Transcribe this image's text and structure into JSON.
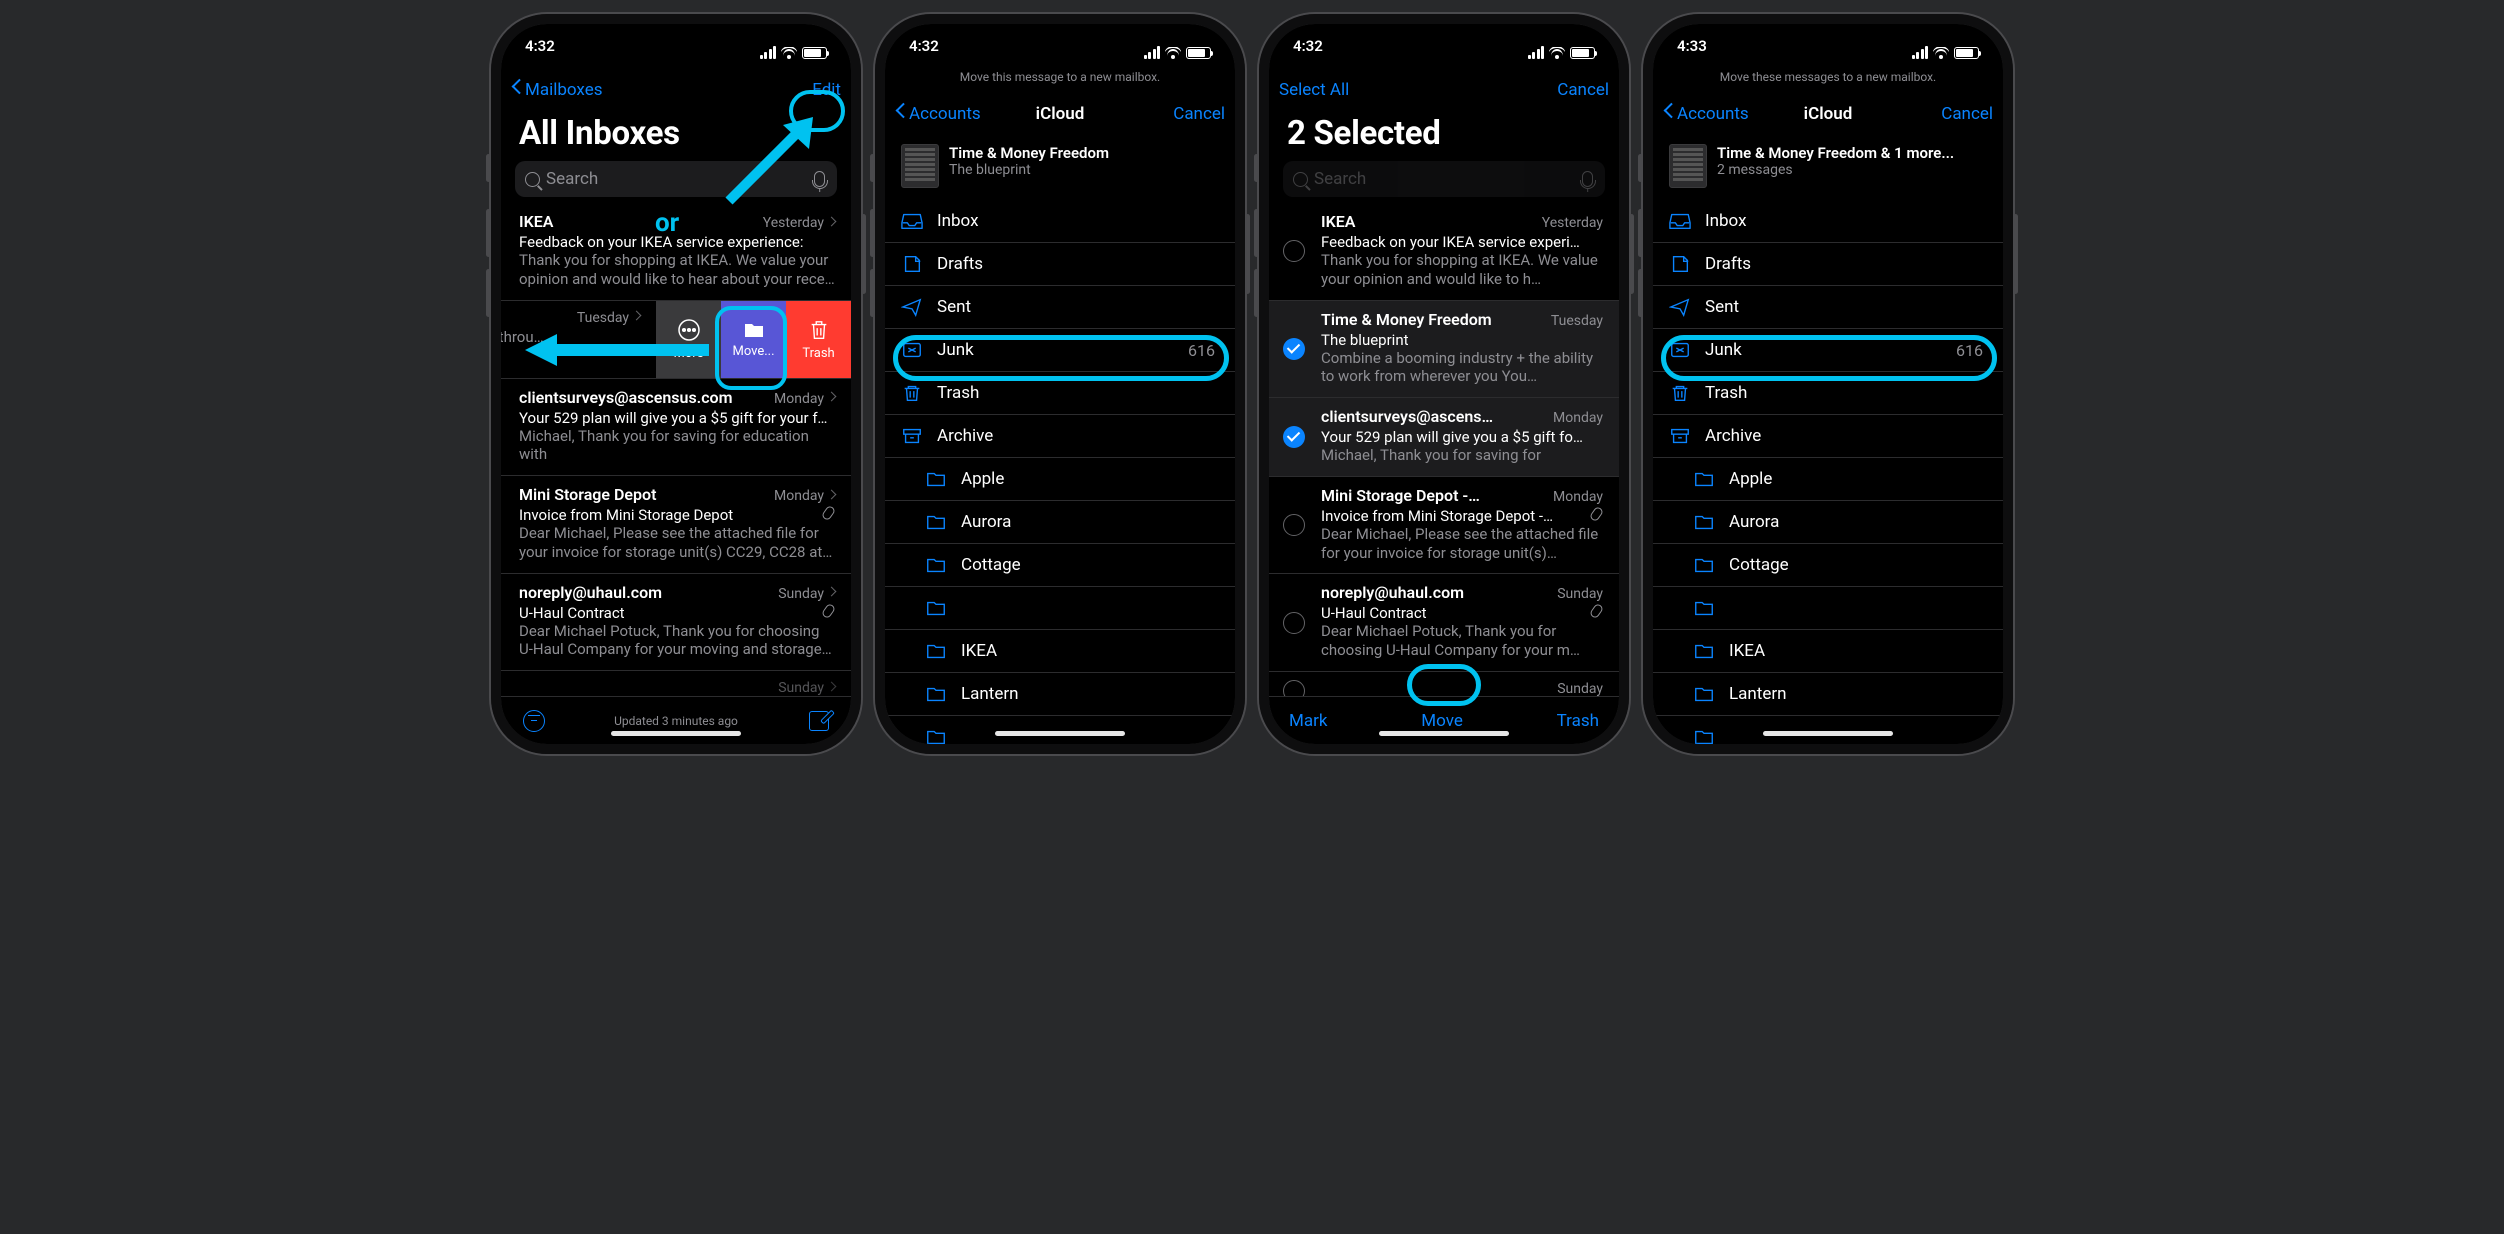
{
  "time": "4:32",
  "time4": "4:33",
  "p1": {
    "back": "Mailboxes",
    "edit": "Edit",
    "title": "All Inboxes",
    "search_ph": "Search",
    "or": "or",
    "status": "Updated 3 minutes ago",
    "swipe": {
      "more": "More",
      "move": "Move...",
      "trash": "Trash"
    },
    "rows": [
      {
        "sender": "IKEA",
        "date": "Yesterday",
        "subj": "Feedback on your IKEA service experience:",
        "prev": "Thank you for shopping at IKEA. We value your opinion and would like to hear about your rece…"
      },
      {
        "sender": "",
        "date": "Tuesday",
        "subj": "",
        "prev": "+ the ability to subscribed throu…"
      },
      {
        "sender": "clientsurveys@ascensus.com",
        "date": "Monday",
        "subj": "Your 529 plan will give you a $5 gift for your fe…",
        "prev": "Michael, Thank you for saving for education with"
      },
      {
        "sender": "Mini Storage Depot",
        "date": "Monday",
        "subj": "Invoice from Mini Storage Depot",
        "prev": "Dear Michael, Please see the attached file for your invoice for storage unit(s) CC29, CC28 at…",
        "attach": true
      },
      {
        "sender": "noreply@uhaul.com",
        "date": "Sunday",
        "subj": "U-Haul Contract",
        "prev": "Dear Michael Potuck, Thank you for choosing U-Haul Company for your moving and storage ne…",
        "attach": true
      },
      {
        "sender": "",
        "date": "Sunday",
        "subj": "",
        "prev": ""
      }
    ]
  },
  "p2": {
    "helper": "Move this message to a new mailbox.",
    "back": "Accounts",
    "title": "iCloud",
    "cancel": "Cancel",
    "msg": {
      "title": "Time & Money Freedom",
      "sub": "The blueprint"
    },
    "junk_count": "616",
    "folders": [
      "Inbox",
      "Drafts",
      "Sent",
      "Junk",
      "Trash",
      "Archive",
      "Apple",
      "Aurora",
      "Cottage",
      "",
      "IKEA",
      "Lantern",
      ""
    ]
  },
  "p3": {
    "selectall": "Select All",
    "cancel": "Cancel",
    "title": "2 Selected",
    "search_ph": "Search",
    "tb": {
      "mark": "Mark",
      "move": "Move",
      "trash": "Trash"
    },
    "rows": [
      {
        "sender": "IKEA",
        "date": "Yesterday",
        "subj": "Feedback on your IKEA service experi…",
        "prev": "Thank you for shopping at IKEA. We value your opinion and would like to h…",
        "sel": false
      },
      {
        "sender": "Time & Money Freedom",
        "date": "Tuesday",
        "subj": "The blueprint",
        "prev": "Combine a booming industry + the ability to work from wherever you You…",
        "sel": true
      },
      {
        "sender": "clientsurveys@ascens…",
        "date": "Monday",
        "subj": "Your 529 plan will give you a $5 gift fo…",
        "prev": "Michael, Thank you for saving for",
        "sel": true
      },
      {
        "sender": "Mini Storage Depot -…",
        "date": "Monday",
        "subj": "Invoice from Mini Storage Depot -…",
        "prev": "Dear Michael, Please see the attached file for your invoice for storage unit(s)…",
        "sel": false,
        "attach": true
      },
      {
        "sender": "noreply@uhaul.com",
        "date": "Sunday",
        "subj": "U-Haul Contract",
        "prev": "Dear Michael Potuck, Thank you for choosing U-Haul Company for your m…",
        "sel": false,
        "attach": true
      },
      {
        "sender": "",
        "date": "Sunday",
        "subj": "",
        "prev": "",
        "sel": false
      }
    ]
  },
  "p4": {
    "helper": "Move these messages to a new mailbox.",
    "back": "Accounts",
    "title": "iCloud",
    "cancel": "Cancel",
    "msg": {
      "title": "Time & Money Freedom & 1 more...",
      "sub": "2 messages"
    },
    "junk_count": "616",
    "folders": [
      "Inbox",
      "Drafts",
      "Sent",
      "Junk",
      "Trash",
      "Archive",
      "Apple",
      "Aurora",
      "Cottage",
      "",
      "IKEA",
      "Lantern",
      ""
    ]
  }
}
